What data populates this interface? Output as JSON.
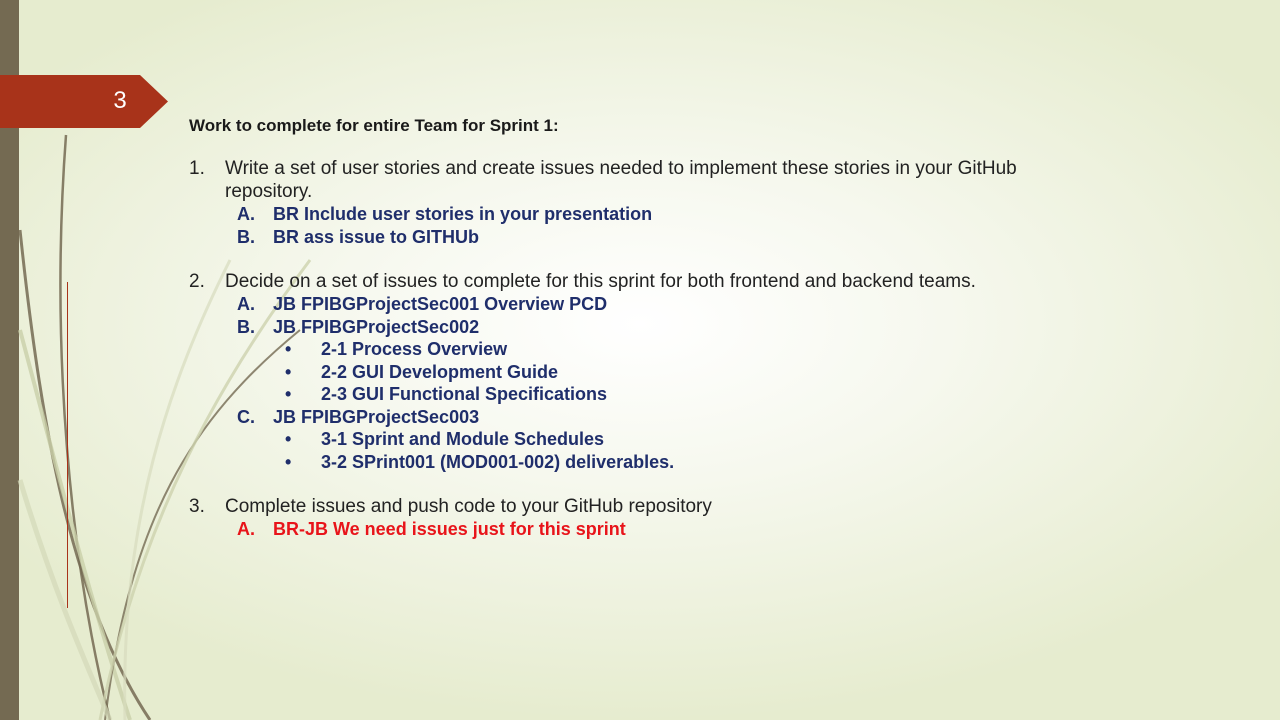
{
  "slide": {
    "number": "3",
    "title": "Work to complete for entire Team for Sprint 1:",
    "items": [
      {
        "num": "1.",
        "text": "Write a set of user stories and create issues needed to implement these stories in your GitHub repository.",
        "subs": [
          {
            "marker": "A.",
            "text": "BR Include user stories in your presentation"
          },
          {
            "marker": "B.",
            "text": "BR ass issue to GITHUb"
          }
        ]
      },
      {
        "num": "2.",
        "text": "Decide on a set of issues to complete for this sprint for both frontend and backend teams.",
        "subs": [
          {
            "marker": "A.",
            "text": "JB FPIBGProjectSec001 Overview PCD"
          },
          {
            "marker": "B.",
            "text": "JB FPIBGProjectSec002"
          },
          {
            "marker": "C.",
            "text": "JB FPIBGProjectSec003"
          }
        ],
        "bullets_b": [
          "2-1 Process Overview",
          "2-2 GUI Development Guide",
          "2-3 GUI Functional Specifications"
        ],
        "bullets_c": [
          "3-1 Sprint and Module Schedules",
          "3-2 SPrint001 (MOD001-002) deliverables."
        ]
      },
      {
        "num": "3.",
        "text": "Complete issues and push code to your GitHub repository",
        "subs": [
          {
            "marker": "A.",
            "text": "BR-JB We need issues just for this sprint"
          }
        ]
      }
    ],
    "bullet_glyph": "•"
  },
  "colors": {
    "side_bar": "#746a52",
    "number_tab": "#a8331a",
    "sub_text": "#1f2e6b",
    "alert_text": "#e8141a"
  }
}
